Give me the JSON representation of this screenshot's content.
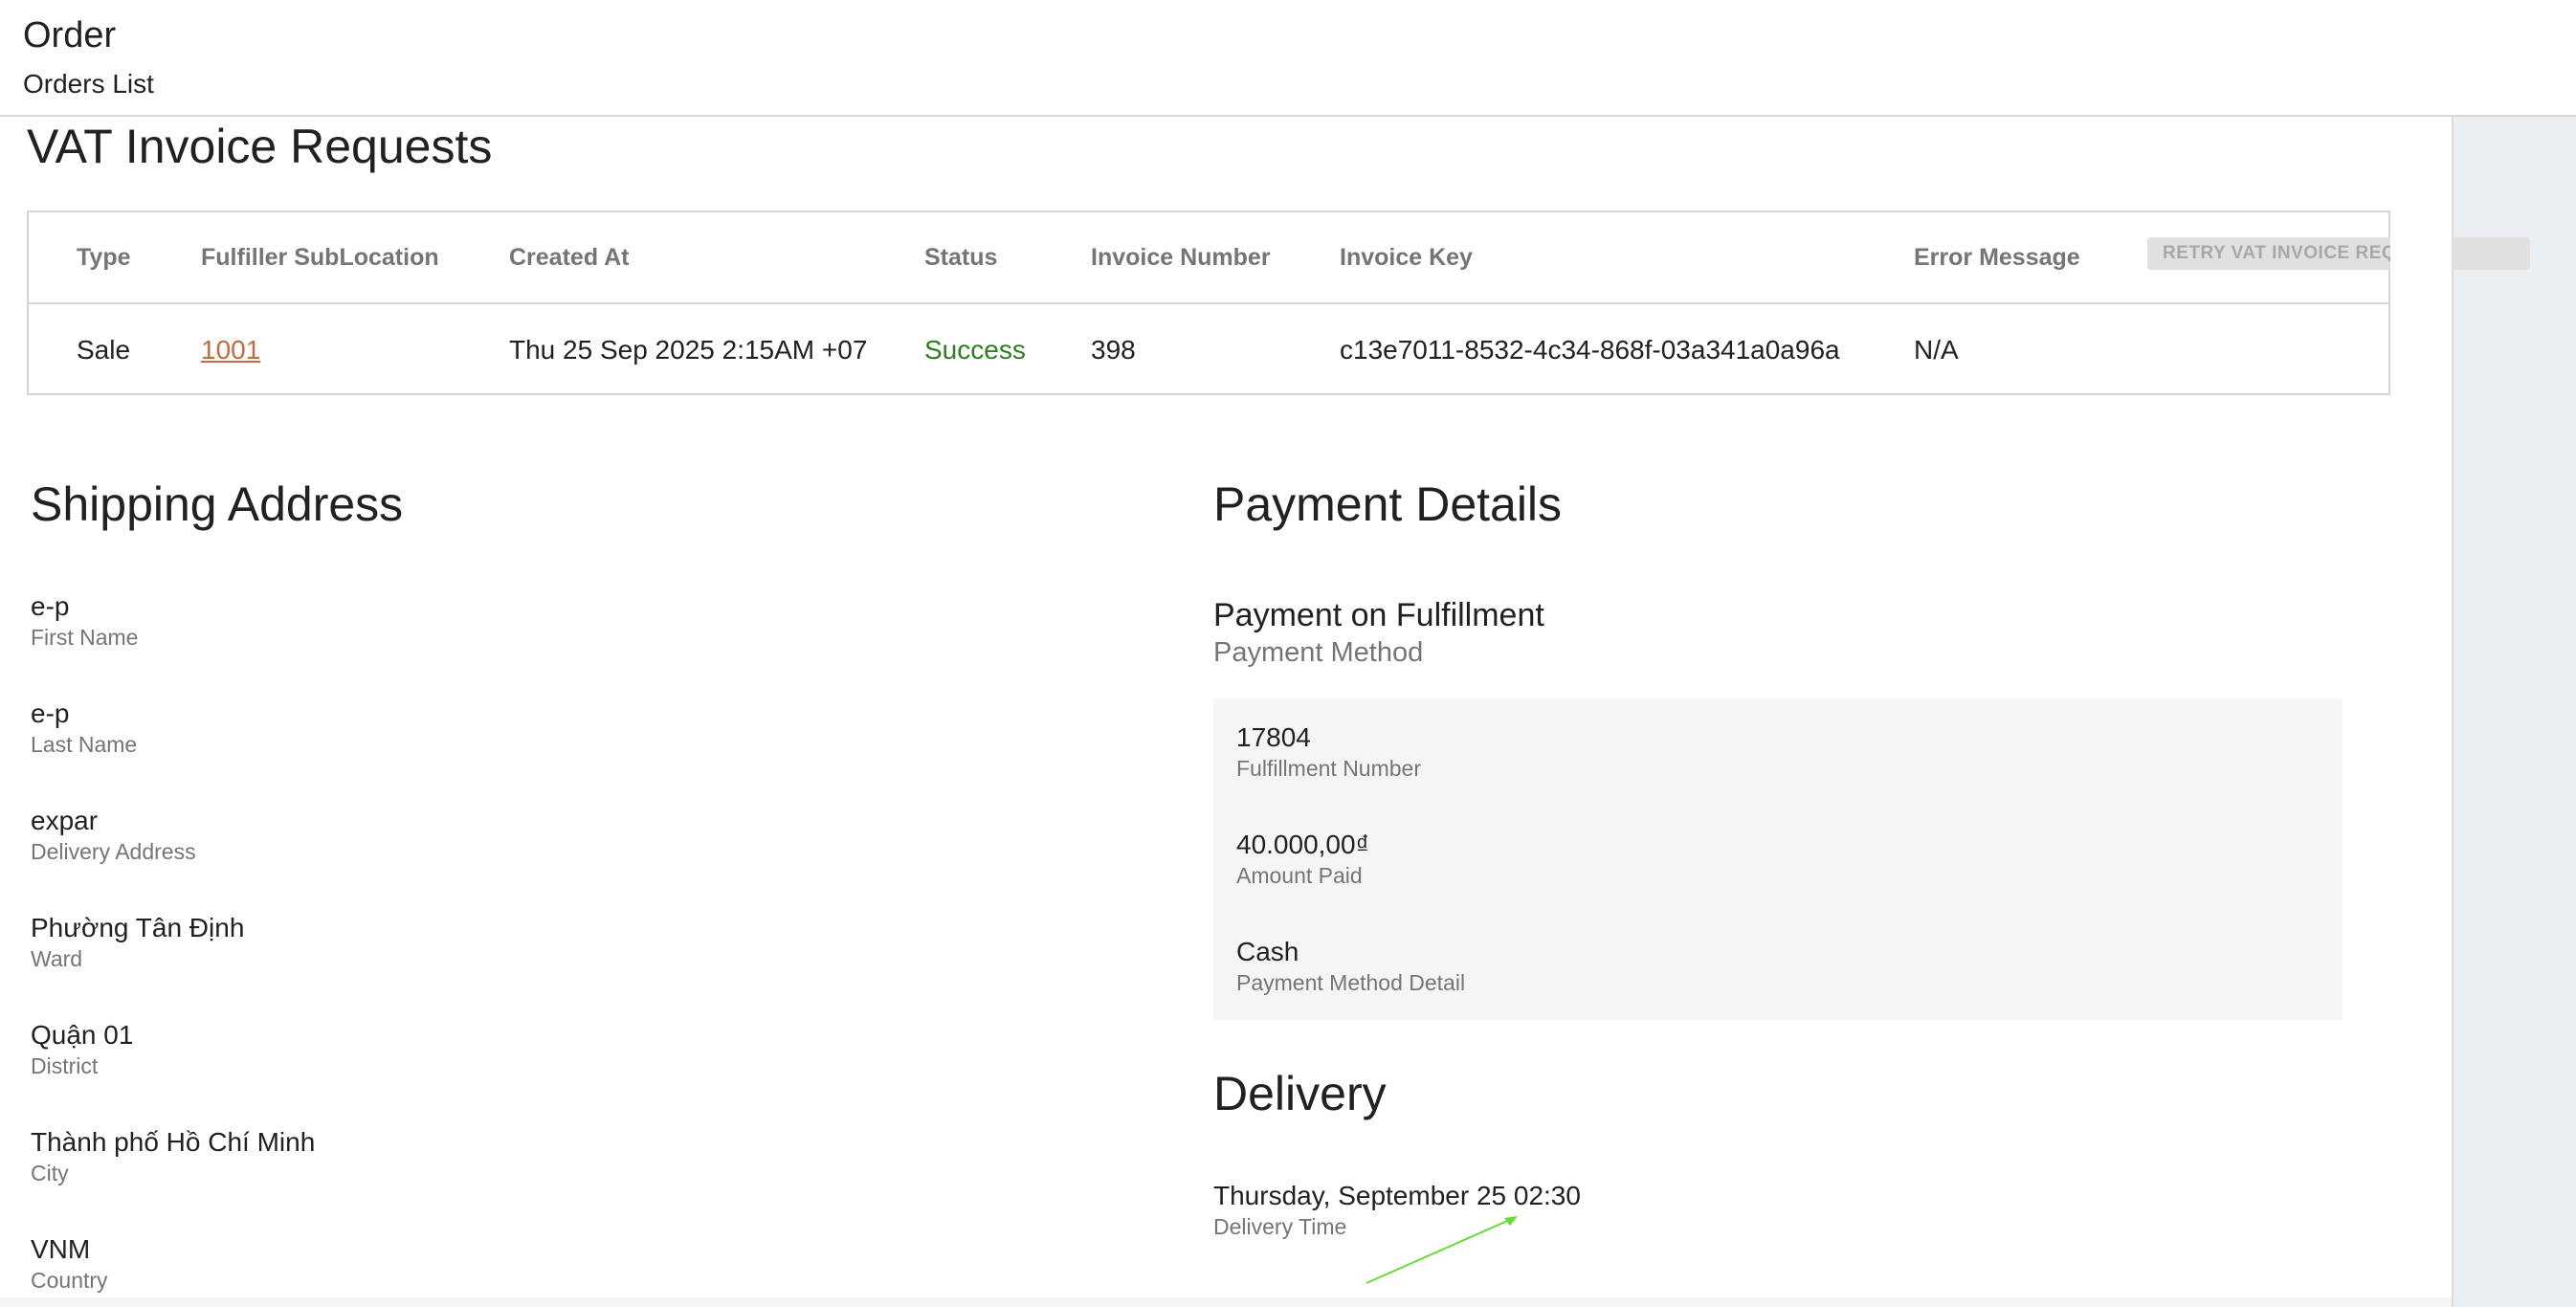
{
  "header": {
    "title": "Order",
    "breadcrumb": "Orders List"
  },
  "vat": {
    "title": "VAT Invoice Requests",
    "columns": [
      "Type",
      "Fulfiller SubLocation",
      "Created At",
      "Status",
      "Invoice Number",
      "Invoice Key",
      "Error Message",
      "Retry VAT Invoice Rec"
    ],
    "rows": [
      {
        "type": "Sale",
        "sublocation": "1001",
        "created_at": "Thu 25 Sep 2025 2:15AM +07",
        "status": "Success",
        "invoice_number": "398",
        "invoice_key": "c13e7011-8532-4c34-868f-03a341a0a96a",
        "error_message": "N/A",
        "retry_label": "RETRY VAT INVOICE REQU"
      }
    ],
    "status_color": "#2e7d1e",
    "link_color": "#c8693f"
  },
  "shipping": {
    "title": "Shipping Address",
    "fields": [
      {
        "value": "e-p",
        "label": "First Name"
      },
      {
        "value": "e-p",
        "label": "Last Name"
      },
      {
        "value": "expar",
        "label": "Delivery Address"
      },
      {
        "value": "Phường Tân Định",
        "label": "Ward"
      },
      {
        "value": "Quận 01",
        "label": "District"
      },
      {
        "value": "Thành phố Hồ Chí Minh",
        "label": "City"
      },
      {
        "value": "VNM",
        "label": "Country"
      }
    ]
  },
  "payment": {
    "title": "Payment Details",
    "method_value": "Payment on Fulfillment",
    "method_label": "Payment Method",
    "box": [
      {
        "value": "17804",
        "label": "Fulfillment Number"
      },
      {
        "value": "40.000,00₫",
        "label": "Amount Paid"
      },
      {
        "value": "Cash",
        "label": "Payment Method Detail"
      }
    ]
  },
  "delivery": {
    "title": "Delivery",
    "time_value": "Thursday, September 25 02:30",
    "time_label": "Delivery Time"
  },
  "annotation": {
    "icon": "arrow-icon",
    "color": "#66dd33"
  }
}
